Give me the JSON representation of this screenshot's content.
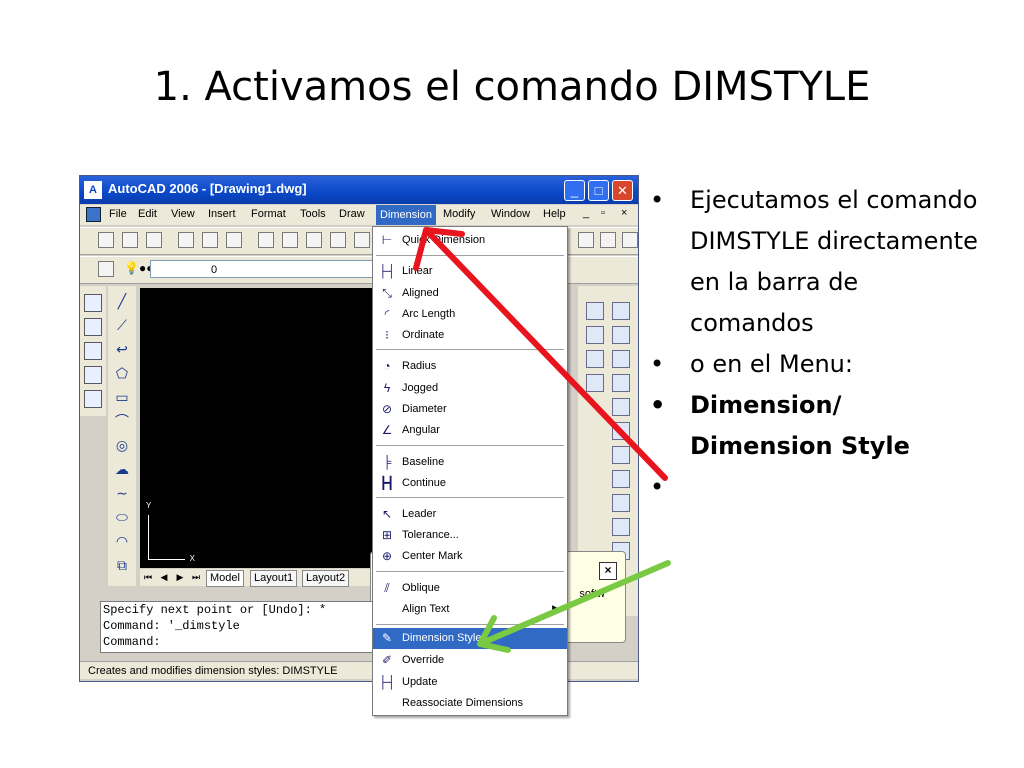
{
  "slide": {
    "title": "1. Activamos el comando DIMSTYLE"
  },
  "window": {
    "title": "AutoCAD 2006 - [Drawing1.dwg]",
    "buttons": {
      "minimize": "_",
      "maximize": "□",
      "close": "✕"
    }
  },
  "menubar": {
    "items": [
      "File",
      "Edit",
      "View",
      "Insert",
      "Format",
      "Tools",
      "Draw",
      "Dimension",
      "Modify",
      "Window",
      "Help"
    ],
    "active": "Dimension",
    "controls": [
      "_",
      "▫",
      "×"
    ]
  },
  "layer_toolbar": {
    "layer_value": "0"
  },
  "tabs": [
    "Model",
    "Layout1",
    "Layout2"
  ],
  "ucs": {
    "y": "Y",
    "x": "X"
  },
  "command_window": {
    "lines": [
      "Specify next point or [Undo]: *",
      "Command: '_dimstyle",
      "Command:"
    ]
  },
  "popup": {
    "close": "×",
    "text": "softw"
  },
  "statusbar": {
    "text": "Creates and modifies dimension styles:  DIMSTYLE"
  },
  "dimension_menu": {
    "items": [
      {
        "label": "Quick Dimension",
        "icon": "quick-dimension-icon"
      },
      {
        "label": "Linear",
        "icon": "linear-icon"
      },
      {
        "label": "Aligned",
        "icon": "aligned-icon"
      },
      {
        "label": "Arc Length",
        "icon": "arc-length-icon"
      },
      {
        "label": "Ordinate",
        "icon": "ordinate-icon"
      },
      {
        "label": "Radius",
        "icon": "radius-icon"
      },
      {
        "label": "Jogged",
        "icon": "jogged-icon"
      },
      {
        "label": "Diameter",
        "icon": "diameter-icon"
      },
      {
        "label": "Angular",
        "icon": "angular-icon"
      },
      {
        "label": "Baseline",
        "icon": "baseline-icon"
      },
      {
        "label": "Continue",
        "icon": "continue-icon"
      },
      {
        "label": "Leader",
        "icon": "leader-icon"
      },
      {
        "label": "Tolerance...",
        "icon": "tolerance-icon"
      },
      {
        "label": "Center Mark",
        "icon": "center-mark-icon"
      },
      {
        "label": "Oblique",
        "icon": "oblique-icon"
      },
      {
        "label": "Align Text",
        "icon": "",
        "submenu": "▶"
      },
      {
        "label": "Dimension Style...",
        "icon": "dimension-style-icon",
        "highlighted": true
      },
      {
        "label": "Override",
        "icon": "override-icon"
      },
      {
        "label": "Update",
        "icon": "update-icon"
      },
      {
        "label": "Reassociate Dimensions",
        "icon": ""
      }
    ]
  },
  "bullets": [
    {
      "text": "Ejecutamos el comando DIMSTYLE directamente en la barra de comandos",
      "bold": false
    },
    {
      "text": "o en el Menu:",
      "bold": false
    },
    {
      "text": "Dimension/ Dimension Style",
      "bold": true
    },
    {
      "text": "",
      "bold": false
    }
  ],
  "bullet_glyph": "•",
  "colors": {
    "title_blue": "#0a48c8",
    "highlight": "#316ac5",
    "red_arrow": "#e8141e",
    "green_arrow": "#7ac943"
  }
}
